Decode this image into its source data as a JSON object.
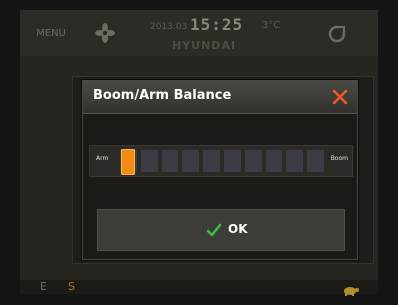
{
  "topbar": {
    "menu_label": "MENU",
    "date": "2013.03",
    "time": "15:25",
    "temperature": "3°C",
    "brand": "HYUNDAI",
    "fan_icon": "fan-icon",
    "engine_icon": "engine-icon"
  },
  "dialog": {
    "title": "Boom/Arm Balance",
    "close_icon": "close-icon",
    "slider": {
      "left_label": "Arm",
      "right_label": "Boom",
      "segments": 10,
      "position": 1
    },
    "ok_label": "OK",
    "ok_icon": "check-icon"
  },
  "bottombar": {
    "mode_label": "E",
    "speed_label": "S"
  },
  "colors": {
    "handle": "#ef8c10",
    "close": "#f05a28",
    "check": "#3cc040"
  }
}
